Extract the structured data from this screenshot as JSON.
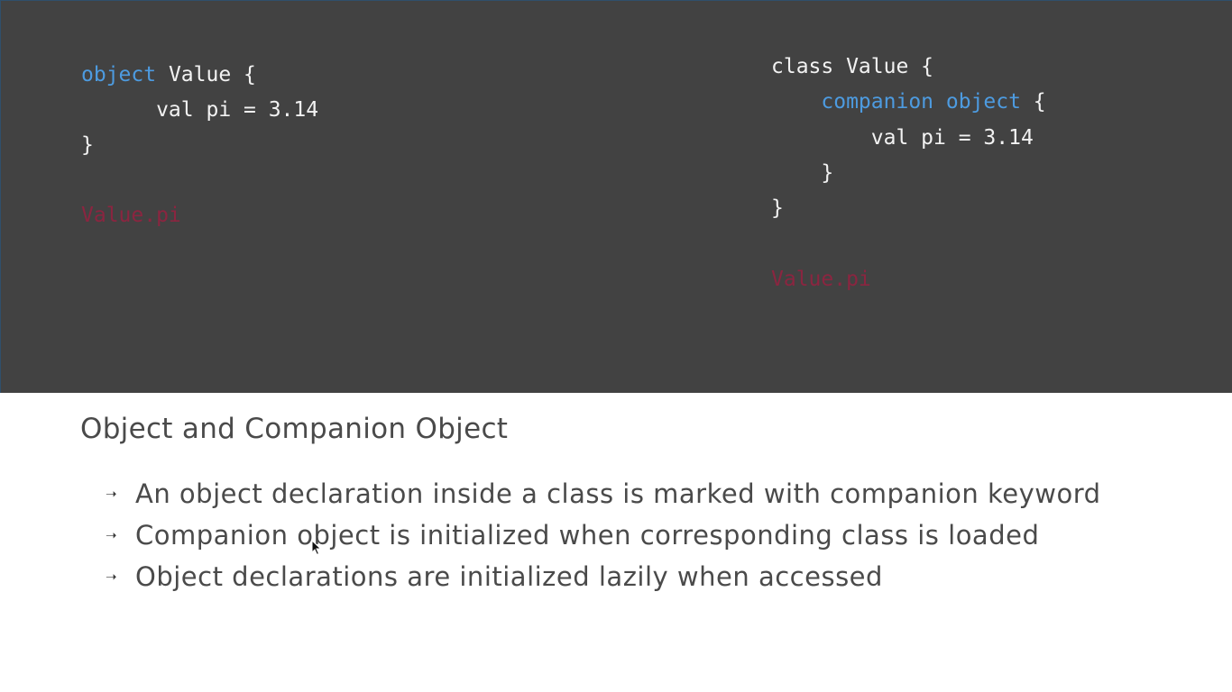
{
  "code_left": {
    "lines": [
      {
        "keyword": "object",
        "text": " Value {"
      },
      {
        "text": "      val pi = 3.14"
      },
      {
        "text": "}"
      },
      {
        "text": ""
      },
      {
        "ref": "Value.pi"
      }
    ]
  },
  "code_right": {
    "lines": [
      {
        "text": "class Value {"
      },
      {
        "indent": "    ",
        "keyword": "companion object",
        "text": " {"
      },
      {
        "text": "        val pi = 3.14"
      },
      {
        "text": "    }"
      },
      {
        "text": "}"
      },
      {
        "text": ""
      },
      {
        "ref": "Value.pi"
      }
    ]
  },
  "slide": {
    "title": "Object and Companion Object",
    "bullet_glyph": "➝",
    "bullets": [
      "An object declaration inside a class is marked with companion keyword",
      "Companion object is initialized when corresponding class is loaded",
      "Object declarations are initialized lazily when accessed"
    ]
  },
  "colors": {
    "code_background": "#424242",
    "keyword": "#4d9be0",
    "reference": "#8b2540",
    "code_text": "#f2f2f2",
    "body_text": "#4a4a4a"
  },
  "icons": {
    "cursor": "mouse-pointer-icon"
  }
}
